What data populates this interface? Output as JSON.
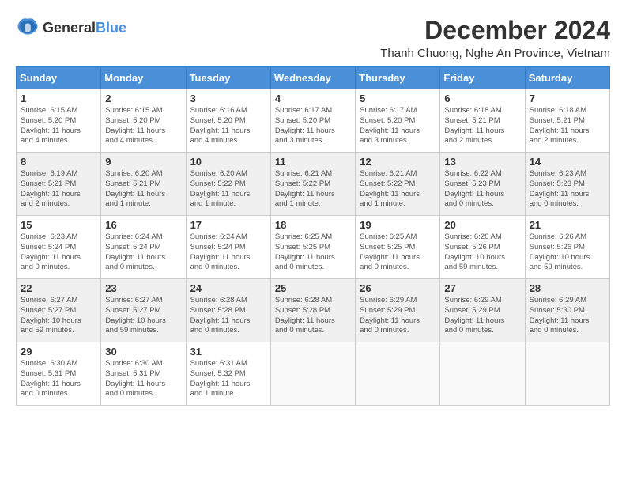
{
  "header": {
    "logo_general": "General",
    "logo_blue": "Blue",
    "month_title": "December 2024",
    "location": "Thanh Chuong, Nghe An Province, Vietnam"
  },
  "calendar": {
    "days_of_week": [
      "Sunday",
      "Monday",
      "Tuesday",
      "Wednesday",
      "Thursday",
      "Friday",
      "Saturday"
    ],
    "weeks": [
      [
        {
          "day": "",
          "info": ""
        },
        {
          "day": "2",
          "info": "Sunrise: 6:15 AM\nSunset: 5:20 PM\nDaylight: 11 hours\nand 4 minutes."
        },
        {
          "day": "3",
          "info": "Sunrise: 6:16 AM\nSunset: 5:20 PM\nDaylight: 11 hours\nand 4 minutes."
        },
        {
          "day": "4",
          "info": "Sunrise: 6:17 AM\nSunset: 5:20 PM\nDaylight: 11 hours\nand 3 minutes."
        },
        {
          "day": "5",
          "info": "Sunrise: 6:17 AM\nSunset: 5:20 PM\nDaylight: 11 hours\nand 3 minutes."
        },
        {
          "day": "6",
          "info": "Sunrise: 6:18 AM\nSunset: 5:21 PM\nDaylight: 11 hours\nand 2 minutes."
        },
        {
          "day": "7",
          "info": "Sunrise: 6:18 AM\nSunset: 5:21 PM\nDaylight: 11 hours\nand 2 minutes."
        }
      ],
      [
        {
          "day": "1",
          "info": "Sunrise: 6:15 AM\nSunset: 5:20 PM\nDaylight: 11 hours\nand 4 minutes."
        },
        {
          "day": "9",
          "info": "Sunrise: 6:20 AM\nSunset: 5:21 PM\nDaylight: 11 hours\nand 1 minute."
        },
        {
          "day": "10",
          "info": "Sunrise: 6:20 AM\nSunset: 5:22 PM\nDaylight: 11 hours\nand 1 minute."
        },
        {
          "day": "11",
          "info": "Sunrise: 6:21 AM\nSunset: 5:22 PM\nDaylight: 11 hours\nand 1 minute."
        },
        {
          "day": "12",
          "info": "Sunrise: 6:21 AM\nSunset: 5:22 PM\nDaylight: 11 hours\nand 1 minute."
        },
        {
          "day": "13",
          "info": "Sunrise: 6:22 AM\nSunset: 5:23 PM\nDaylight: 11 hours\nand 0 minutes."
        },
        {
          "day": "14",
          "info": "Sunrise: 6:23 AM\nSunset: 5:23 PM\nDaylight: 11 hours\nand 0 minutes."
        }
      ],
      [
        {
          "day": "8",
          "info": "Sunrise: 6:19 AM\nSunset: 5:21 PM\nDaylight: 11 hours\nand 2 minutes."
        },
        {
          "day": "16",
          "info": "Sunrise: 6:24 AM\nSunset: 5:24 PM\nDaylight: 11 hours\nand 0 minutes."
        },
        {
          "day": "17",
          "info": "Sunrise: 6:24 AM\nSunset: 5:24 PM\nDaylight: 11 hours\nand 0 minutes."
        },
        {
          "day": "18",
          "info": "Sunrise: 6:25 AM\nSunset: 5:25 PM\nDaylight: 11 hours\nand 0 minutes."
        },
        {
          "day": "19",
          "info": "Sunrise: 6:25 AM\nSunset: 5:25 PM\nDaylight: 11 hours\nand 0 minutes."
        },
        {
          "day": "20",
          "info": "Sunrise: 6:26 AM\nSunset: 5:26 PM\nDaylight: 10 hours\nand 59 minutes."
        },
        {
          "day": "21",
          "info": "Sunrise: 6:26 AM\nSunset: 5:26 PM\nDaylight: 10 hours\nand 59 minutes."
        }
      ],
      [
        {
          "day": "15",
          "info": "Sunrise: 6:23 AM\nSunset: 5:24 PM\nDaylight: 11 hours\nand 0 minutes."
        },
        {
          "day": "23",
          "info": "Sunrise: 6:27 AM\nSunset: 5:27 PM\nDaylight: 10 hours\nand 59 minutes."
        },
        {
          "day": "24",
          "info": "Sunrise: 6:28 AM\nSunset: 5:28 PM\nDaylight: 11 hours\nand 0 minutes."
        },
        {
          "day": "25",
          "info": "Sunrise: 6:28 AM\nSunset: 5:28 PM\nDaylight: 11 hours\nand 0 minutes."
        },
        {
          "day": "26",
          "info": "Sunrise: 6:29 AM\nSunset: 5:29 PM\nDaylight: 11 hours\nand 0 minutes."
        },
        {
          "day": "27",
          "info": "Sunrise: 6:29 AM\nSunset: 5:29 PM\nDaylight: 11 hours\nand 0 minutes."
        },
        {
          "day": "28",
          "info": "Sunrise: 6:29 AM\nSunset: 5:30 PM\nDaylight: 11 hours\nand 0 minutes."
        }
      ],
      [
        {
          "day": "22",
          "info": "Sunrise: 6:27 AM\nSunset: 5:27 PM\nDaylight: 10 hours\nand 59 minutes."
        },
        {
          "day": "30",
          "info": "Sunrise: 6:30 AM\nSunset: 5:31 PM\nDaylight: 11 hours\nand 0 minutes."
        },
        {
          "day": "31",
          "info": "Sunrise: 6:31 AM\nSunset: 5:32 PM\nDaylight: 11 hours\nand 1 minute."
        },
        {
          "day": "",
          "info": ""
        },
        {
          "day": "",
          "info": ""
        },
        {
          "day": "",
          "info": ""
        },
        {
          "day": "",
          "info": ""
        }
      ],
      [
        {
          "day": "29",
          "info": "Sunrise: 6:30 AM\nSunset: 5:31 PM\nDaylight: 11 hours\nand 0 minutes."
        },
        {
          "day": "",
          "info": ""
        },
        {
          "day": "",
          "info": ""
        },
        {
          "day": "",
          "info": ""
        },
        {
          "day": "",
          "info": ""
        },
        {
          "day": "",
          "info": ""
        },
        {
          "day": "",
          "info": ""
        }
      ]
    ]
  }
}
